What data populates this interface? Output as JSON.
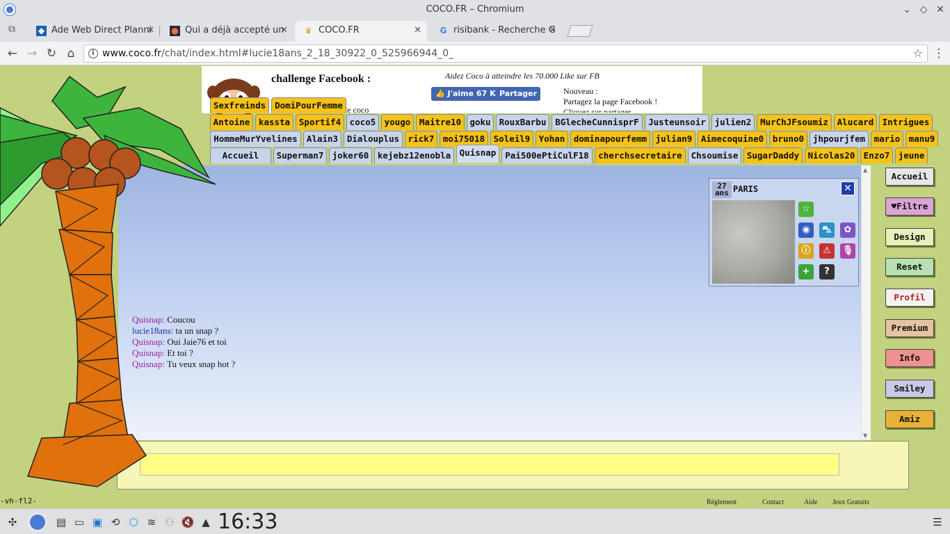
{
  "window": {
    "title": "COCO.FR – Chromium",
    "controls": [
      "chevron-down",
      "diamond",
      "close"
    ]
  },
  "tabs": [
    {
      "label": "Ade Web Direct Planni",
      "favicon": "ade-favicon",
      "active": false
    },
    {
      "label": "Qui a déjà accepté un",
      "favicon": "qui-favicon",
      "active": false
    },
    {
      "label": "COCO.FR",
      "favicon": "crown-favicon",
      "active": true
    },
    {
      "label": "risibank - Recherche G",
      "favicon": "google-favicon",
      "active": false
    }
  ],
  "toolbar": {
    "url_host": "www.coco.fr",
    "url_path": "/chat/index.html#lucie18ans_2_18_30922_0_525966944_0_"
  },
  "banner": {
    "title": "challenge Facebook :",
    "subtitle": "le coco",
    "aidez": "Aidez Coco à atteindre les 70.000 Like sur FB",
    "like_label": "J'aime 67 K",
    "share_label": "Partager",
    "nouveau_lines": [
      "Nouveau :",
      "Partagez la page Facebook !",
      "Cliquez sur partager"
    ]
  },
  "nick_rows": [
    [
      {
        "name": "Sexfreinds",
        "color": "yellow"
      },
      {
        "name": "DomiPourFemme",
        "color": "yellow"
      }
    ],
    [
      {
        "name": "Antoine",
        "color": "yellow"
      },
      {
        "name": "kassta",
        "color": "yellow"
      },
      {
        "name": "Sportif4",
        "color": "yellow"
      },
      {
        "name": "coco5",
        "color": "blue"
      },
      {
        "name": "yougo",
        "color": "yellow"
      },
      {
        "name": "Maitre10",
        "color": "yellow"
      },
      {
        "name": "goku",
        "color": "blue"
      },
      {
        "name": "RouxBarbu",
        "color": "blue"
      },
      {
        "name": "BGlecheCunnisprF",
        "color": "blue"
      },
      {
        "name": "Justeunsoir",
        "color": "blue"
      },
      {
        "name": "julien2",
        "color": "blue"
      },
      {
        "name": "MurChJFsoumiz",
        "color": "yellow"
      },
      {
        "name": "Alucard",
        "color": "yellow"
      },
      {
        "name": "Intrigues",
        "color": "yellow"
      }
    ],
    [
      {
        "name": "HommeMurYvelines",
        "color": "blue"
      },
      {
        "name": "Alain3",
        "color": "blue"
      },
      {
        "name": "Dialouplus",
        "color": "blue"
      },
      {
        "name": "rick7",
        "color": "yellow"
      },
      {
        "name": "moi75018",
        "color": "yellow"
      },
      {
        "name": "Soleil9",
        "color": "yellow"
      },
      {
        "name": "Yohan",
        "color": "yellow"
      },
      {
        "name": "dominapourfemm",
        "color": "yellow"
      },
      {
        "name": "julian9",
        "color": "yellow"
      },
      {
        "name": "Aimecoquine0",
        "color": "yellow"
      },
      {
        "name": "bruno0",
        "color": "yellow"
      },
      {
        "name": "jhpourjfem",
        "color": "blue"
      },
      {
        "name": "mario",
        "color": "yellow"
      },
      {
        "name": "manu9",
        "color": "yellow"
      }
    ],
    [
      {
        "name": "Accueil",
        "color": "blue"
      },
      {
        "name": "Superman7",
        "color": "blue"
      },
      {
        "name": "joker60",
        "color": "blue"
      },
      {
        "name": "kejebz12enobla",
        "color": "blue"
      },
      {
        "name": "Quisnap",
        "color": "active"
      },
      {
        "name": "Pai500ePtiCulF18",
        "color": "blue"
      },
      {
        "name": "cherchsecretaire",
        "color": "yellow"
      },
      {
        "name": "Chsoumise",
        "color": "blue"
      },
      {
        "name": "SugarDaddy",
        "color": "yellow"
      },
      {
        "name": "Nicolas20",
        "color": "yellow"
      },
      {
        "name": "Enzo7",
        "color": "yellow"
      },
      {
        "name": "jeune",
        "color": "yellow"
      }
    ]
  ],
  "messages": [
    {
      "who": "Quisnap:",
      "text": "Coucou",
      "me": false
    },
    {
      "who": "lucie18ans:",
      "text": "ta un snap ?",
      "me": true
    },
    {
      "who": "Quisnap:",
      "text": "Oui Jaie76 et toi",
      "me": false
    },
    {
      "who": "Quisnap:",
      "text": "Et toi ?",
      "me": false
    },
    {
      "who": "Quisnap:",
      "text": "Tu veux snap hot ?",
      "me": false
    }
  ],
  "profile": {
    "age_num": "27",
    "age_unit": "ans",
    "city": "PARIS",
    "icons": [
      "star-icon",
      "webcam-icon",
      "car-icon",
      "flower-icon",
      "info-icon",
      "alert-icon",
      "microphone-icon",
      "add-friend-icon",
      "help-icon"
    ]
  },
  "side_buttons": [
    {
      "label": "Accueil",
      "color": "#e6e6e6",
      "text_color": "#111"
    },
    {
      "label": "♥Filtre",
      "color": "#d9a4d6",
      "text_color": "#111"
    },
    {
      "label": "Design",
      "color": "#e8efb8",
      "text_color": "#111"
    },
    {
      "label": "Reset",
      "color": "#b9e0b3",
      "text_color": "#111"
    },
    {
      "label": "Profil",
      "color": "#f2f2f2",
      "text_color": "#c01a1a"
    },
    {
      "label": "Premium",
      "color": "#e6c3a0",
      "text_color": "#111"
    },
    {
      "label": "Info",
      "color": "#ee9191",
      "text_color": "#111"
    },
    {
      "label": "Smiley",
      "color": "#c7c9e6",
      "text_color": "#111"
    },
    {
      "label": "Amiz",
      "color": "#e7b23a",
      "text_color": "#111"
    }
  ],
  "input": {
    "value": "",
    "placeholder": ""
  },
  "footer": {
    "left_text": "-vh-fl2-",
    "links": [
      "Réglement",
      "Contact",
      "Aide",
      "Jeux Gratuits"
    ]
  },
  "taskbar": {
    "clock": "16:33"
  },
  "colors": {
    "page_bg": "#c3d27e",
    "nick_yellow": "#f5c21a",
    "nick_blue": "#c8d4ec",
    "sender_color": "#9b1da0",
    "me_color": "#1d2ea0"
  }
}
